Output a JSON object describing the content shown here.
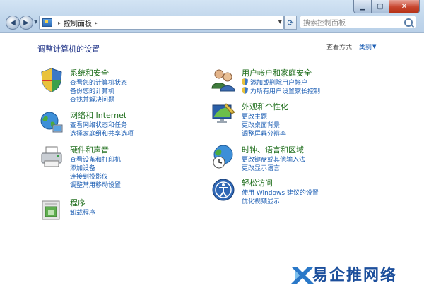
{
  "window": {
    "min_label": "▁",
    "max_label": "▢",
    "close_label": "✕"
  },
  "nav": {
    "back_label": "◀",
    "forward_label": "▶",
    "address": "控制面板",
    "search_placeholder": "搜索控制面板"
  },
  "page": {
    "title": "调整计算机的设置",
    "view_by_label": "查看方式:",
    "view_by_value": "类别"
  },
  "categories_left": [
    {
      "icon": "shield-icon",
      "title": "系统和安全",
      "links": [
        "查看您的计算机状态",
        "备份您的计算机",
        "查找并解决问题"
      ]
    },
    {
      "icon": "network-globe-icon",
      "title": "网络和 Internet",
      "links": [
        "查看网络状态和任务",
        "选择家庭组和共享选项"
      ]
    },
    {
      "icon": "printer-icon",
      "title": "硬件和声音",
      "links": [
        "查看设备和打印机",
        "添加设备",
        "连接到投影仪",
        "调整常用移动设置"
      ]
    },
    {
      "icon": "programs-icon",
      "title": "程序",
      "links": [
        "卸载程序"
      ]
    }
  ],
  "categories_right": [
    {
      "icon": "users-icon",
      "title": "用户帐户和家庭安全",
      "links": [
        "添加或删除用户帐户",
        "为所有用户设置家长控制"
      ]
    },
    {
      "icon": "appearance-icon",
      "title": "外观和个性化",
      "links": [
        "更改主题",
        "更改桌面背景",
        "调整屏幕分辨率"
      ]
    },
    {
      "icon": "clock-globe-icon",
      "title": "时钟、语言和区域",
      "links": [
        "更改键盘或其他输入法",
        "更改显示语言"
      ]
    },
    {
      "icon": "ease-of-access-icon",
      "title": "轻松访问",
      "links": [
        "使用 Windows 建议的设置",
        "优化视频显示"
      ]
    }
  ],
  "watermark": {
    "text": "易企推网络"
  },
  "colors": {
    "title_green": "#1f6e1c",
    "link_blue": "#1e5fb4",
    "heading_blue": "#1e3287"
  }
}
